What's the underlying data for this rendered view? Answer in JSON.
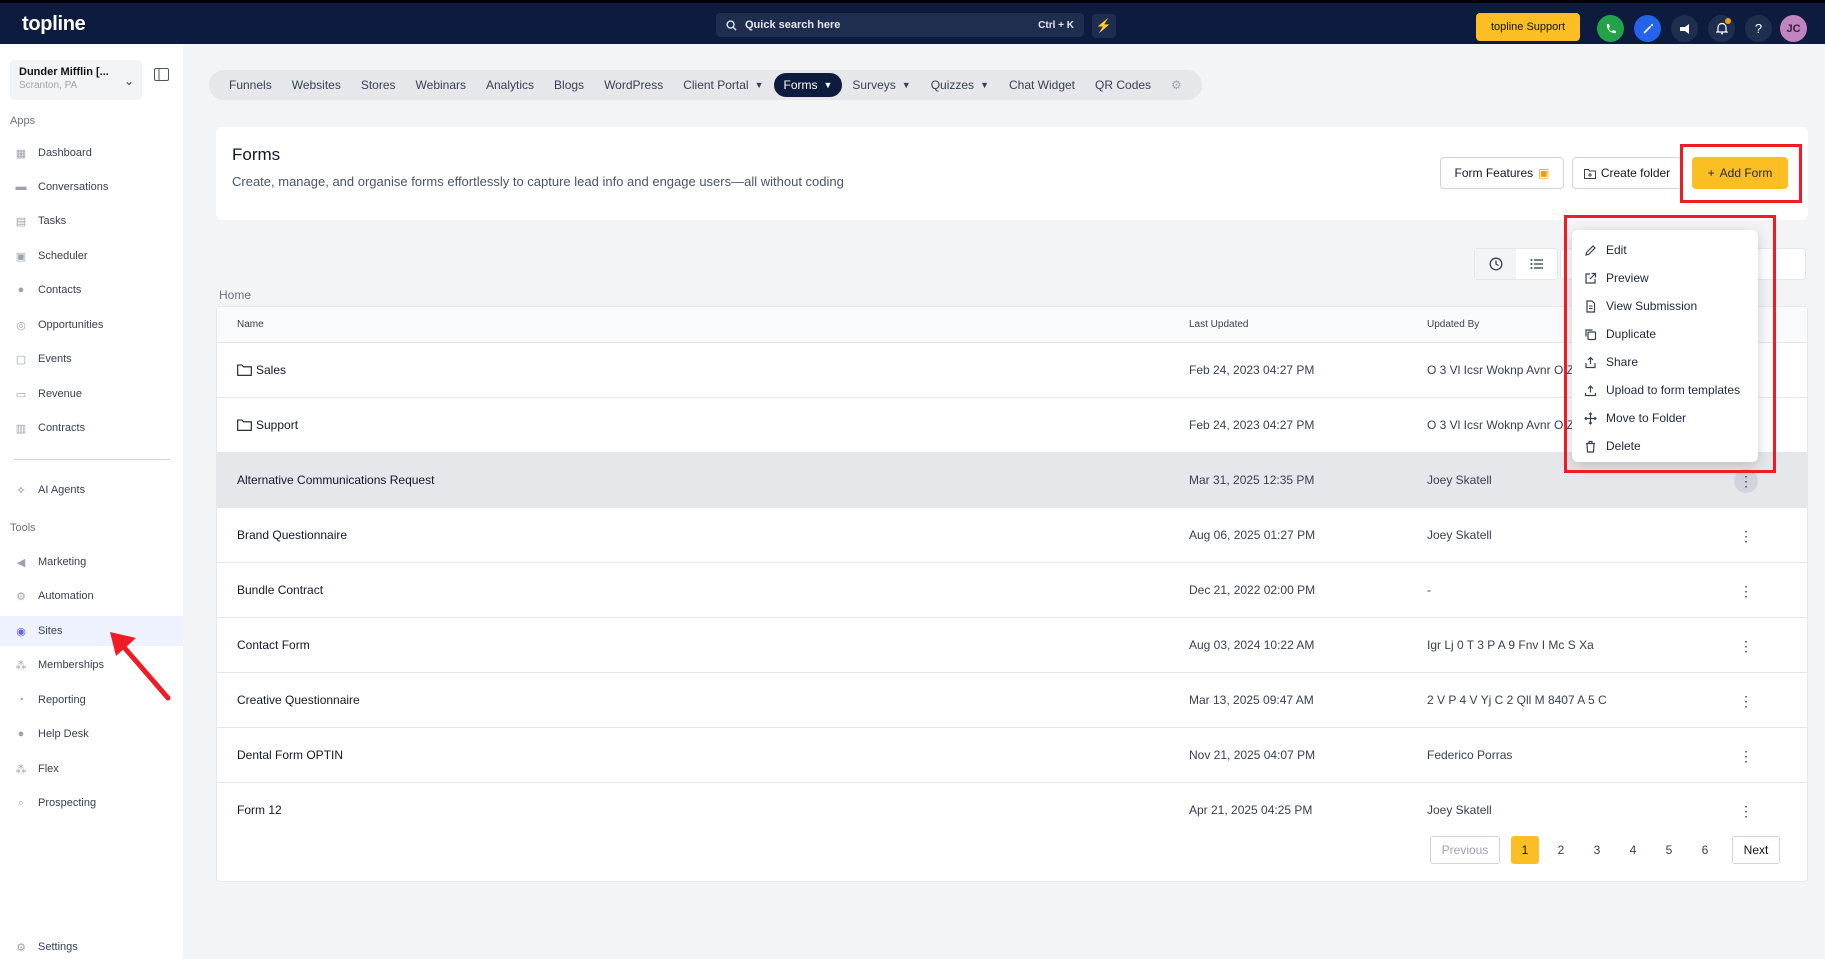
{
  "topbar": {
    "logo": "topline",
    "search_placeholder": "Quick search here",
    "search_shortcut": "Ctrl + K",
    "support_label": "topline Support",
    "avatar_initials": "JC"
  },
  "sidebar": {
    "location_name": "Dunder Mifflin [...",
    "location_sub": "Scranton, PA",
    "apps_label": "Apps",
    "tools_label": "Tools",
    "apps": [
      {
        "label": "Dashboard",
        "icon": "dashboard-icon"
      },
      {
        "label": "Conversations",
        "icon": "conversations-icon"
      },
      {
        "label": "Tasks",
        "icon": "tasks-icon"
      },
      {
        "label": "Scheduler",
        "icon": "calendar-icon"
      },
      {
        "label": "Contacts",
        "icon": "contacts-icon"
      },
      {
        "label": "Opportunities",
        "icon": "opportunities-icon"
      },
      {
        "label": "Events",
        "icon": "events-icon"
      },
      {
        "label": "Revenue",
        "icon": "revenue-icon"
      },
      {
        "label": "Contracts",
        "icon": "contracts-icon"
      }
    ],
    "ai_agents": "AI Agents",
    "tools": [
      {
        "label": "Marketing",
        "icon": "megaphone-icon"
      },
      {
        "label": "Automation",
        "icon": "automation-icon"
      },
      {
        "label": "Sites",
        "icon": "globe-icon"
      },
      {
        "label": "Memberships",
        "icon": "memberships-icon"
      },
      {
        "label": "Reporting",
        "icon": "reporting-icon"
      },
      {
        "label": "Help Desk",
        "icon": "help-desk-icon"
      },
      {
        "label": "Flex",
        "icon": "flex-icon"
      },
      {
        "label": "Prospecting",
        "icon": "prospecting-icon"
      }
    ],
    "settings": "Settings"
  },
  "tabs": [
    {
      "label": "Funnels"
    },
    {
      "label": "Websites"
    },
    {
      "label": "Stores"
    },
    {
      "label": "Webinars"
    },
    {
      "label": "Analytics"
    },
    {
      "label": "Blogs"
    },
    {
      "label": "WordPress"
    },
    {
      "label": "Client Portal",
      "dropdown": true
    },
    {
      "label": "Forms",
      "dropdown": true,
      "active": true
    },
    {
      "label": "Surveys",
      "dropdown": true
    },
    {
      "label": "Quizzes",
      "dropdown": true
    },
    {
      "label": "Chat Widget"
    },
    {
      "label": "QR Codes"
    }
  ],
  "header": {
    "title": "Forms",
    "description": "Create, manage, and organise forms effortlessly to capture lead info and engage users—all without coding",
    "form_features": "Form Features",
    "create_folder": "Create folder",
    "add_form": "Add Form"
  },
  "breadcrumb": "Home",
  "table": {
    "columns": {
      "name": "Name",
      "last_updated": "Last Updated",
      "updated_by": "Updated By"
    },
    "rows": [
      {
        "name": "Sales",
        "folder": true,
        "updated": "Feb 24, 2023 04:27 PM",
        "by": "O 3 Vl Icsr Woknp Avnr O Z"
      },
      {
        "name": "Support",
        "folder": true,
        "updated": "Feb 24, 2023 04:27 PM",
        "by": "O 3 Vl Icsr Woknp Avnr O Z"
      },
      {
        "name": "Alternative Communications Request",
        "updated": "Mar 31, 2025 12:35 PM",
        "by": "Joey Skatell"
      },
      {
        "name": "Brand Questionnaire",
        "updated": "Aug 06, 2025 01:27 PM",
        "by": "Joey Skatell"
      },
      {
        "name": "Bundle Contract",
        "updated": "Dec 21, 2022 02:00 PM",
        "by": "-"
      },
      {
        "name": "Contact Form",
        "updated": "Aug 03, 2024 10:22 AM",
        "by": "Igr Lj 0 T 3 P A 9 Fnv I Mc S Xa"
      },
      {
        "name": "Creative Questionnaire",
        "updated": "Mar 13, 2025 09:47 AM",
        "by": "2 V P 4 V Yj C 2 Qll M 8407 A 5 C"
      },
      {
        "name": "Dental Form OPTIN",
        "updated": "Nov 21, 2025 04:07 PM",
        "by": "Federico Porras"
      },
      {
        "name": "Form 12",
        "updated": "Apr 21, 2025 04:25 PM",
        "by": "Joey Skatell"
      }
    ]
  },
  "pagination": {
    "previous": "Previous",
    "next": "Next",
    "pages": [
      "1",
      "2",
      "3",
      "4",
      "5",
      "6"
    ],
    "current": "1"
  },
  "menu": [
    {
      "label": "Edit",
      "icon": "pencil-icon"
    },
    {
      "label": "Preview",
      "icon": "external-link-icon"
    },
    {
      "label": "View Submission",
      "icon": "document-icon"
    },
    {
      "label": "Duplicate",
      "icon": "copy-icon"
    },
    {
      "label": "Share",
      "icon": "share-icon"
    },
    {
      "label": "Upload to form templates",
      "icon": "upload-icon"
    },
    {
      "label": "Move to Folder",
      "icon": "move-icon"
    },
    {
      "label": "Delete",
      "icon": "trash-icon"
    }
  ],
  "colors": {
    "navy": "#0d1b3e",
    "accent": "#fbbf24",
    "highlight": "#ef1c25"
  }
}
